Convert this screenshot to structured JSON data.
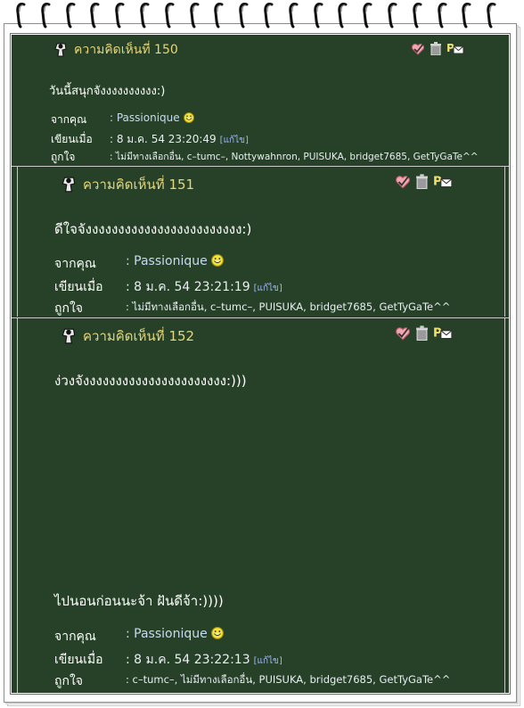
{
  "posts": [
    {
      "heading": "ความคิดเห็นที่ 150",
      "message": "วันนี้สนุกจังงงงงงงงงง:)",
      "extra_message": "",
      "from_label": "จากคุณ",
      "from_value": ": Passionique",
      "time_label": "เขียนเมื่อ",
      "time_value": ": 8 ม.ค. 54 23:20:49",
      "edit_label": "[แก้ไข]",
      "likes_label": "ถูกใจ",
      "likes_value": ": ไม่มีทางเลือกอื่น, c–tumc–, Nottywahnron, PUISUKA, bridget7685, GetTyGaTe^^"
    },
    {
      "heading": "ความคิดเห็นที่ 151",
      "message": "ดีใจจังงงงงงงงงงงงงงงงงงงงงงงง:)",
      "extra_message": "",
      "from_label": "จากคุณ",
      "from_value": ": Passionique",
      "time_label": "เขียนเมื่อ",
      "time_value": ": 8 ม.ค. 54 23:21:19",
      "edit_label": "[แก้ไข]",
      "likes_label": "ถูกใจ",
      "likes_value": ": ไม่มีทางเลือกอื่น, c–tumc–, PUISUKA, bridget7685, GetTyGaTe^^"
    },
    {
      "heading": "ความคิดเห็นที่ 152",
      "message": "ง่วงจังงงงงงงงงงงงงงงงงงงงงง:)))",
      "extra_message": "ไปนอนก่อนนะจ้า ฝันดีจ้า:))))",
      "from_label": "จากคุณ",
      "from_value": ": Passionique",
      "time_label": "เขียนเมื่อ",
      "time_value": ": 8 ม.ค. 54 23:22:13",
      "edit_label": "[แก้ไข]",
      "likes_label": "ถูกใจ",
      "likes_value": ": c–tumc–, ไม่มีทางเลือกอื่น, PUISUKA, bridget7685, GetTyGaTe^^"
    }
  ],
  "icons": {
    "avatar": "user-avatar-icon",
    "like": "heart-check-icon",
    "delete": "trash-icon",
    "message": "private-message-icon",
    "smiley": "smiley-icon"
  },
  "colors": {
    "board": "#264127",
    "heading": "#e6d67a",
    "text": "#ffffff",
    "edit_link": "#9db5ff"
  }
}
